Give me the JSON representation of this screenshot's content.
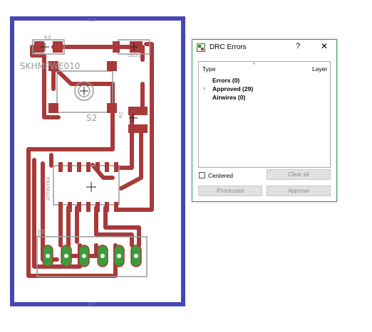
{
  "board": {
    "component_label": "SKHMPWE010",
    "switch_ref": "S2",
    "resistor_ref": "R3",
    "resistor2_ref": "R2",
    "led_ref": "LED1",
    "chip_ref": "ATTINY84",
    "header_ref": "JX",
    "net_label": "NET"
  },
  "colors": {
    "board_outline": "#4646b4",
    "trace": "#a83a3a",
    "pad": "#a83a3a",
    "pad_approved": "#3c9c3c",
    "silkscreen": "#9a9a9a"
  },
  "drc_dialog": {
    "title": "DRC Errors",
    "icon": "drc-app-icon",
    "help": "?",
    "close": "✕",
    "columns": {
      "type": "Type",
      "layer": "Layer"
    },
    "sort_indicator": "^",
    "items": [
      {
        "label": "Errors (0)",
        "expandable": false
      },
      {
        "label": "Approved (29)",
        "expandable": true
      },
      {
        "label": "Airwires (0)",
        "expandable": false
      }
    ],
    "expander": "›",
    "centered_label": "Centered",
    "centered_checked": false,
    "buttons": {
      "clear_all": "Clear all",
      "processed": "Processed",
      "approve": "Approve"
    }
  }
}
